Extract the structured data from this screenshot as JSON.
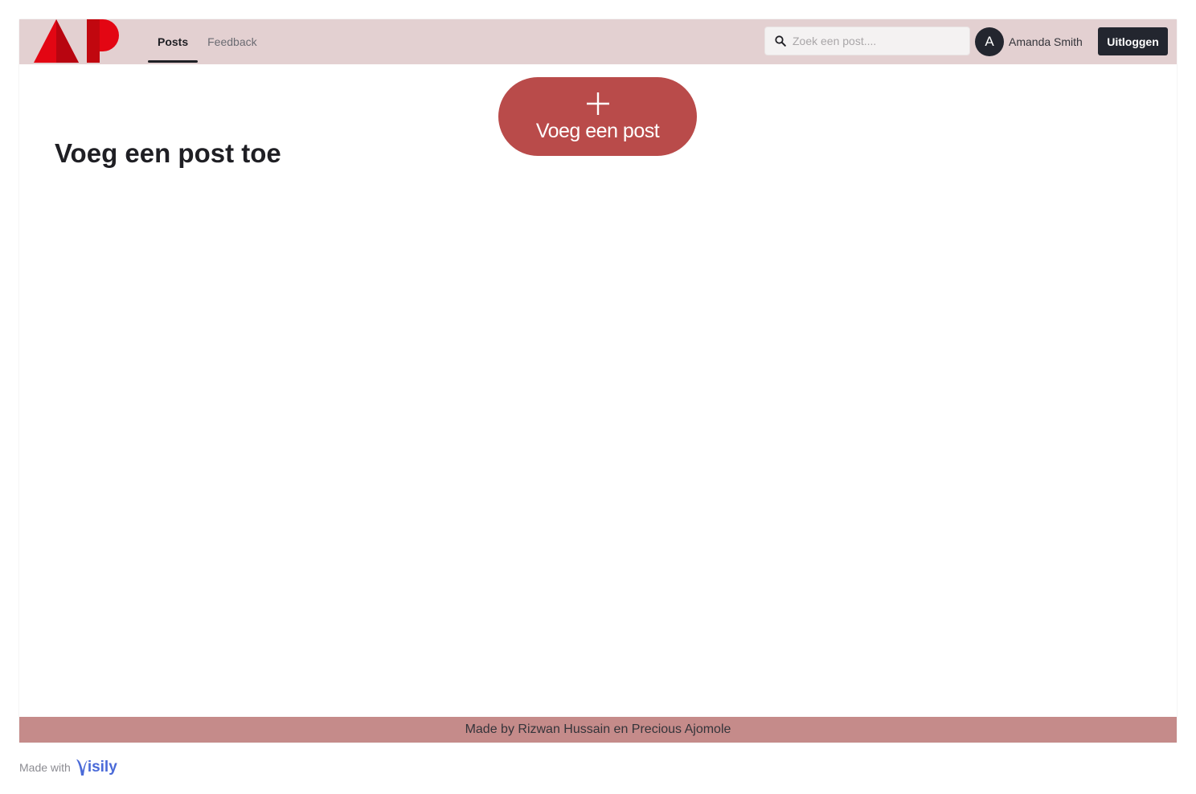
{
  "header": {
    "logo_text": "AP",
    "nav": [
      {
        "label": "Posts",
        "active": true
      },
      {
        "label": "Feedback",
        "active": false
      }
    ],
    "search": {
      "placeholder": "Zoek een post....",
      "value": "",
      "icon": "search-icon"
    },
    "user": {
      "avatar_initial": "A",
      "name": "Amanda Smith"
    },
    "logout_label": "Uitloggen"
  },
  "main": {
    "add_post_button": {
      "label": "Voeg een post",
      "icon": "plus-icon"
    },
    "title": "Voeg een post toe"
  },
  "footer": {
    "credits": "Made by Rizwan Hussain en Precious Ajomole"
  },
  "badge": {
    "prefix": "Made with",
    "brand": "isily",
    "brand_full": "Visily"
  },
  "colors": {
    "header_bg": "#e3d0d1",
    "accent": "#b94b4a",
    "footer_bg": "#c58b8a",
    "dark": "#23262f",
    "logo_red": "#e30613",
    "visily_blue": "#4a6ad8"
  }
}
